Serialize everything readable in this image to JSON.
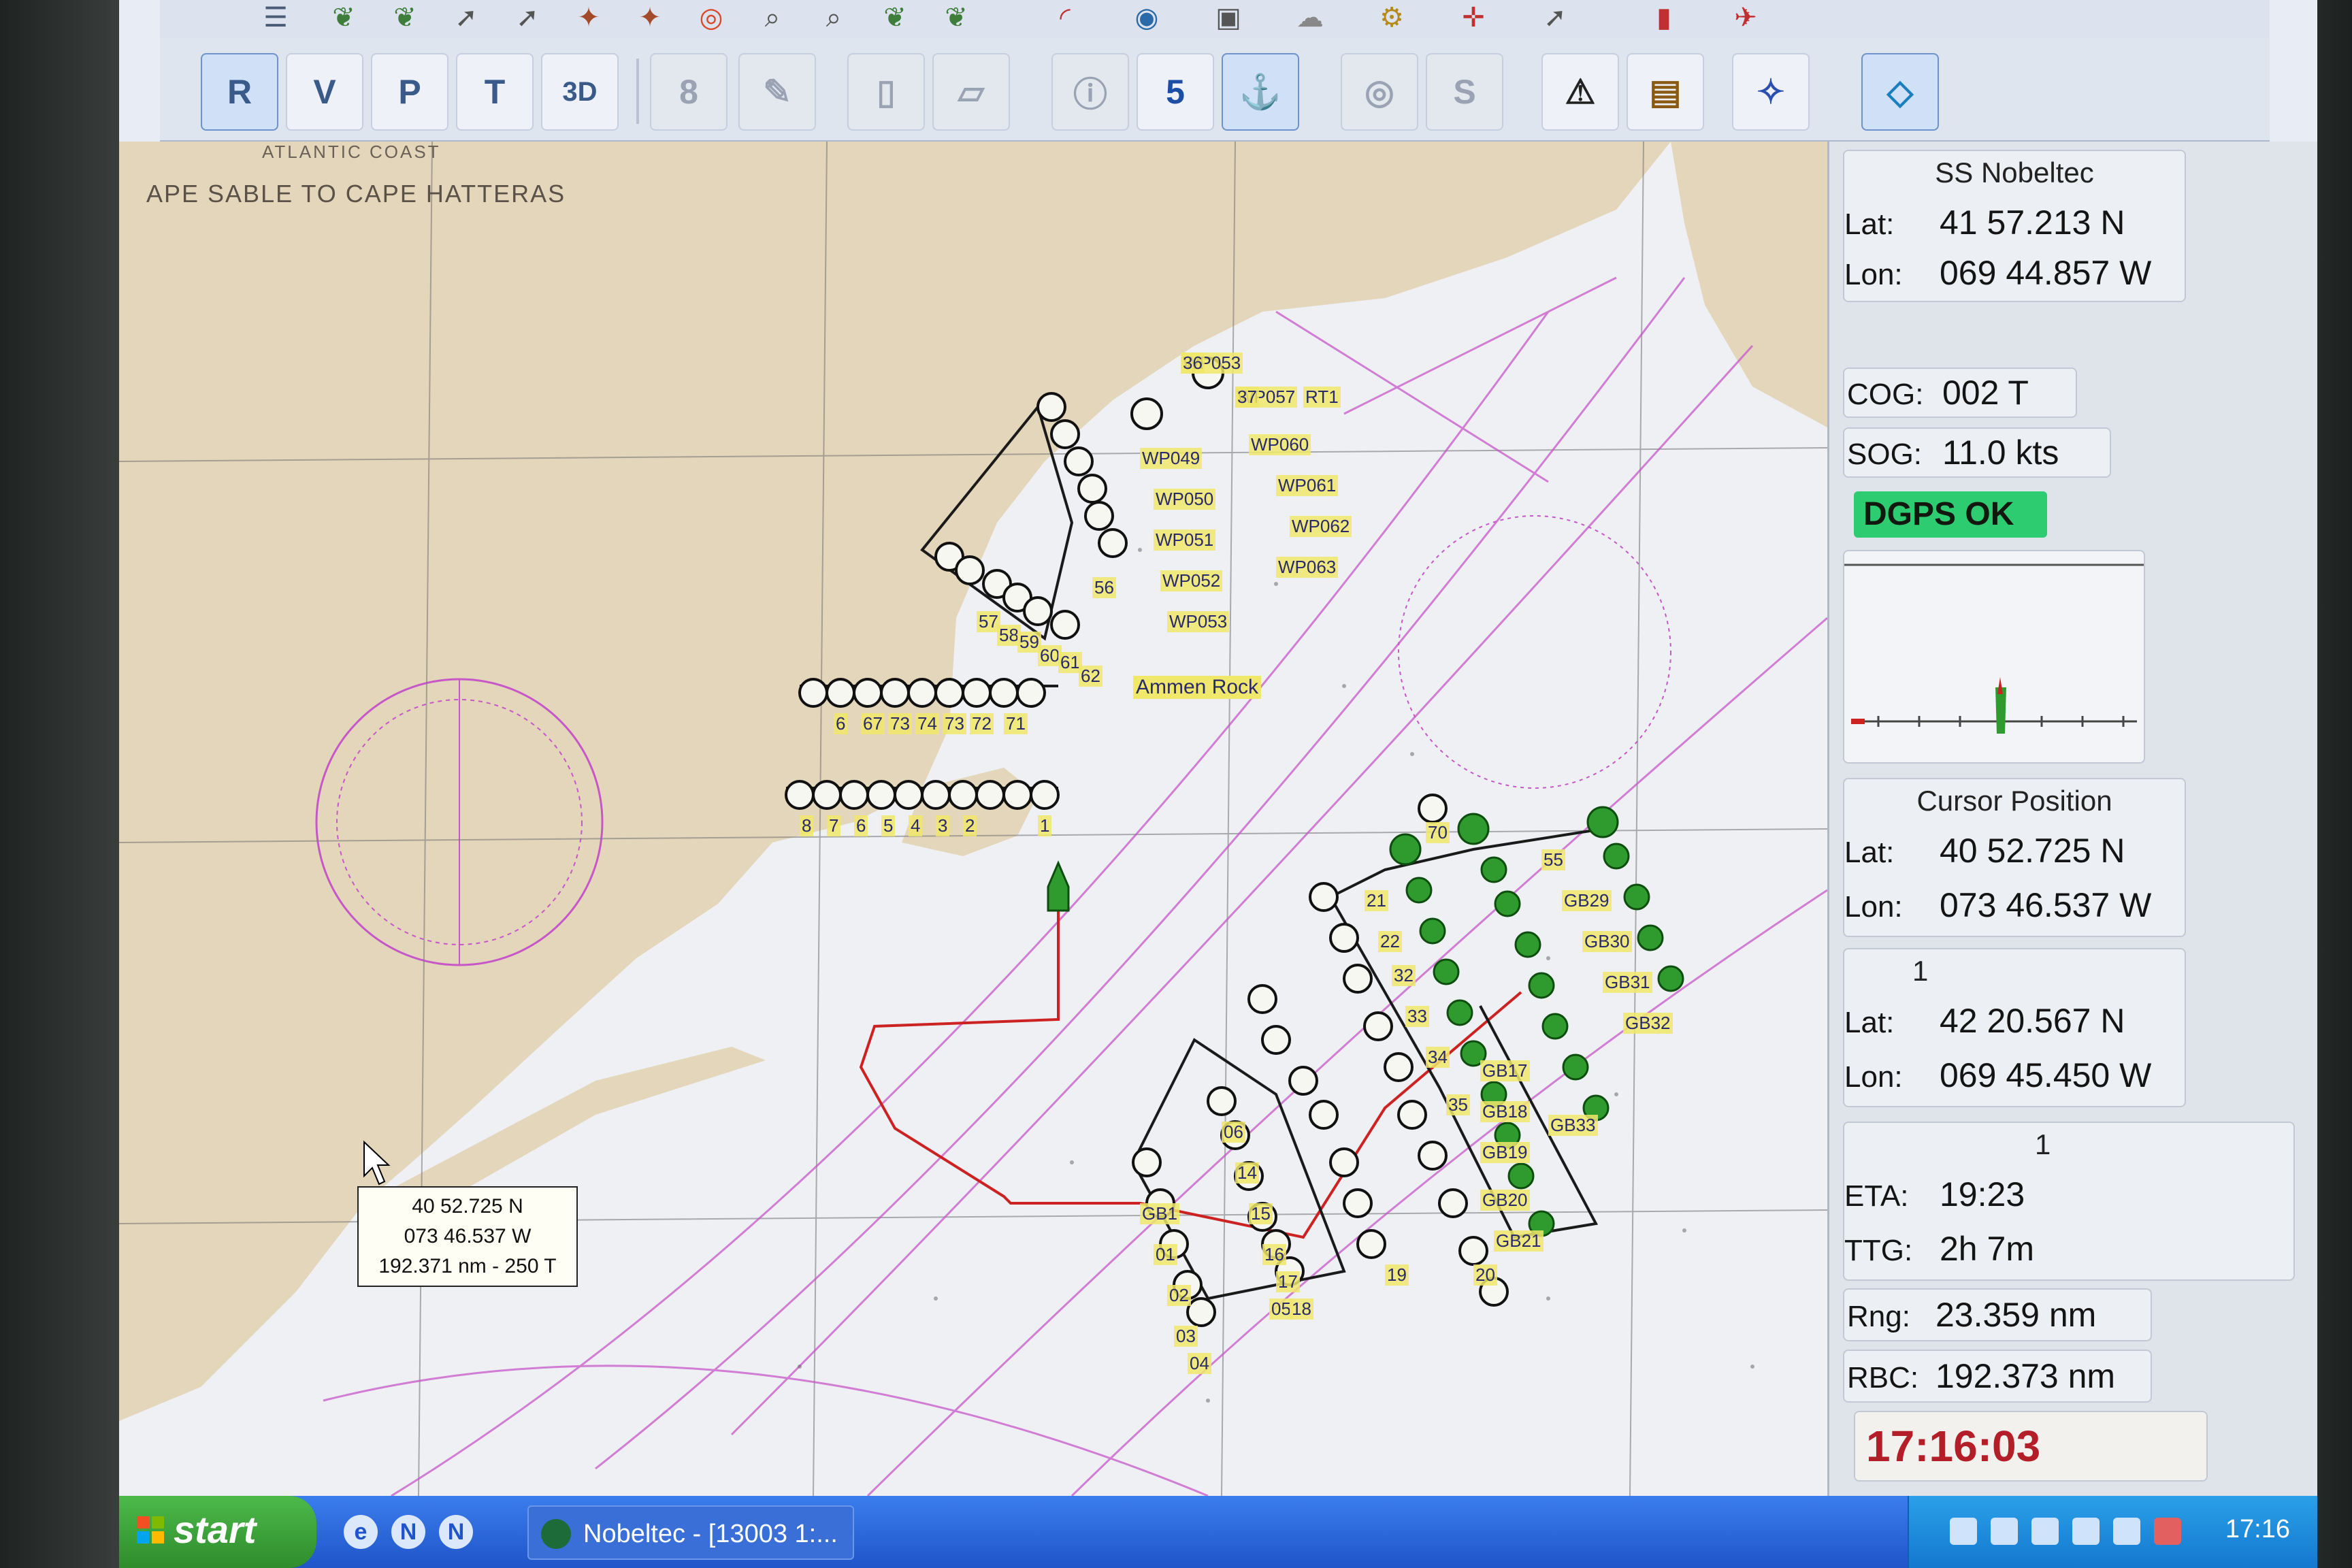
{
  "app": {
    "taskbar_title": "Nobeltec - [13003 1:..."
  },
  "toolbar": {
    "buttons": [
      {
        "label": "R",
        "icon": "raster-chart-icon"
      },
      {
        "label": "V",
        "icon": "vector-chart-icon"
      },
      {
        "label": "P",
        "icon": "photo-chart-icon"
      },
      {
        "label": "T",
        "icon": "tide-chart-icon"
      },
      {
        "label": "3D",
        "icon": "3d-view-icon"
      },
      {
        "label": "8",
        "icon": "layer-icon"
      },
      {
        "label": "5",
        "icon": "route-shield-icon"
      },
      {
        "label": "S",
        "icon": "sounding-icon"
      }
    ]
  },
  "chart": {
    "title": "APE SABLE TO CAPE HATTERAS",
    "subtitle": "ATLANTIC COAST",
    "place_label": "Ammen Rock",
    "cursor_tooltip": {
      "lat": "40 52.725 N",
      "lon": "073 46.537 W",
      "range_bearing": "192.371 nm - 250 T"
    },
    "route_labels": [
      "WP053",
      "WP057",
      "WP049",
      "WP050",
      "WP051",
      "WP052",
      "WP053",
      "WP060",
      "WP061",
      "WP062",
      "WP063",
      "RT1",
      "56",
      "57",
      "58",
      "59",
      "60",
      "61",
      "62",
      "8",
      "7",
      "6",
      "5",
      "4",
      "3",
      "2",
      "1",
      "6",
      "67",
      "73",
      "74",
      "73",
      "72",
      "71",
      "70",
      "55",
      "GB29",
      "GB30",
      "GB31",
      "GB32",
      "GB33",
      "GB21",
      "GB20",
      "GB19",
      "GB18",
      "GB17",
      "GB1",
      "01",
      "02",
      "03",
      "04",
      "05",
      "06",
      "14",
      "15",
      "16",
      "17",
      "18",
      "19",
      "20",
      "21",
      "22",
      "32",
      "33",
      "34",
      "35",
      "36",
      "37"
    ]
  },
  "panel": {
    "vessel": {
      "title": "SS Nobeltec",
      "lat_label": "Lat:",
      "lat": "41 57.213 N",
      "lon_label": "Lon:",
      "lon": "069 44.857 W"
    },
    "cog": {
      "label": "COG:",
      "value": "002 T"
    },
    "sog": {
      "label": "SOG:",
      "value": "11.0 kts"
    },
    "gps_status": "DGPS OK",
    "cursor": {
      "title": "Cursor Position",
      "lat_label": "Lat:",
      "lat": "40 52.725 N",
      "lon_label": "Lon:",
      "lon": "073 46.537 W"
    },
    "waypoint": {
      "title": "1",
      "lat_label": "Lat:",
      "lat": "42 20.567 N",
      "lon_label": "Lon:",
      "lon": "069 45.450 W"
    },
    "eta_box": {
      "title": "1",
      "eta_label": "ETA:",
      "eta": "19:23",
      "ttg_label": "TTG:",
      "ttg": "2h 7m"
    },
    "rng": {
      "label": "Rng:",
      "value": "23.359 nm"
    },
    "rbc": {
      "label": "RBC:",
      "value": "192.373 nm"
    },
    "clock": "17:16:03"
  },
  "taskbar": {
    "start": "start",
    "time": "17:16"
  },
  "colors": {
    "land": "#e3d4b8",
    "water": "#eef0f4",
    "route_line": "#cc2222",
    "waypoint_green": "#2f9b2f",
    "magenta_lines": "#c657c8",
    "gps_ok": "#2ecc71",
    "clock_red": "#b41e28"
  }
}
